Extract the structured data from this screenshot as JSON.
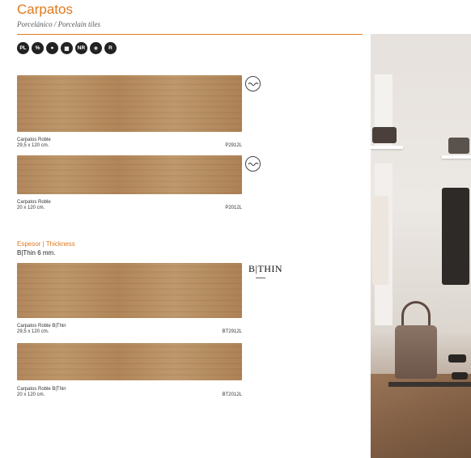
{
  "header": {
    "title": "Carpatos",
    "subtitle": "Porcelánico / Porcelain tiles"
  },
  "feature_icons": [
    "PL",
    "%",
    "●",
    "▦",
    "NR",
    "✳",
    "R"
  ],
  "tiles": [
    {
      "name": "Carpatos Roble",
      "size": "29,5 x 120 cm.",
      "code": "P2912L"
    },
    {
      "name": "Carpatos Roble",
      "size": "20 x 120 cm.",
      "code": "P2012L"
    }
  ],
  "thickness": {
    "heading": "Espesor | Thickness",
    "value": "B|Thin 6 mm.",
    "logo": "B|THIN"
  },
  "bthin_tiles": [
    {
      "name": "Carpatos Roble B|Thin",
      "size": "29,5 x 120 cm.",
      "code": "BT2912L"
    },
    {
      "name": "Carpatos Roble B|Thin",
      "size": "20 x 120 cm.",
      "code": "BT2012L"
    }
  ]
}
